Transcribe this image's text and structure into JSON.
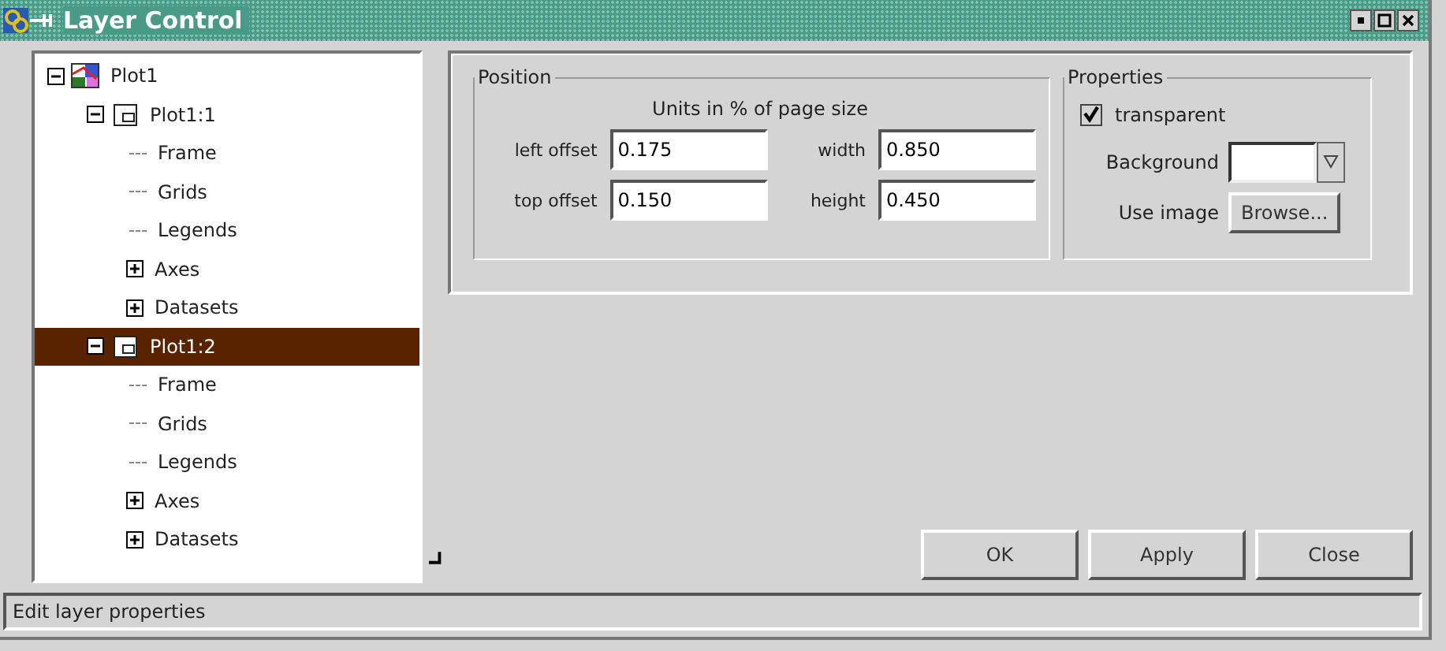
{
  "window": {
    "title": "Layer Control"
  },
  "tree": [
    {
      "label": "Plot1",
      "kind": "plot",
      "expanded": true,
      "selected": false,
      "children": [
        {
          "label": "Plot1:1",
          "kind": "layer",
          "expanded": true,
          "selected": false,
          "children": [
            {
              "label": "Frame",
              "kind": "leaf",
              "selected": false
            },
            {
              "label": "Grids",
              "kind": "leaf",
              "selected": false
            },
            {
              "label": "Legends",
              "kind": "leaf",
              "selected": false
            },
            {
              "label": "Axes",
              "kind": "folder",
              "expanded": false,
              "selected": false
            },
            {
              "label": "Datasets",
              "kind": "folder",
              "expanded": false,
              "selected": false
            }
          ]
        },
        {
          "label": "Plot1:2",
          "kind": "layer",
          "expanded": true,
          "selected": true,
          "children": [
            {
              "label": "Frame",
              "kind": "leaf",
              "selected": false
            },
            {
              "label": "Grids",
              "kind": "leaf",
              "selected": false
            },
            {
              "label": "Legends",
              "kind": "leaf",
              "selected": false
            },
            {
              "label": "Axes",
              "kind": "folder",
              "expanded": false,
              "selected": false
            },
            {
              "label": "Datasets",
              "kind": "folder",
              "expanded": false,
              "selected": false
            }
          ]
        }
      ]
    }
  ],
  "position": {
    "title": "Position",
    "units": "Units in % of page size",
    "fields": [
      {
        "label": "left offset",
        "value": "0.175"
      },
      {
        "label": "width",
        "value": "0.850"
      },
      {
        "label": "top offset",
        "value": "0.150"
      },
      {
        "label": "height",
        "value": "0.450"
      }
    ]
  },
  "properties": {
    "title": "Properties",
    "transparent": {
      "label": "transparent",
      "checked": true
    },
    "background_label": "Background",
    "image_label": "Use image",
    "browse": "Browse..."
  },
  "buttons": [
    "OK",
    "Apply",
    "Close"
  ],
  "status_bar": "Edit layer properties"
}
